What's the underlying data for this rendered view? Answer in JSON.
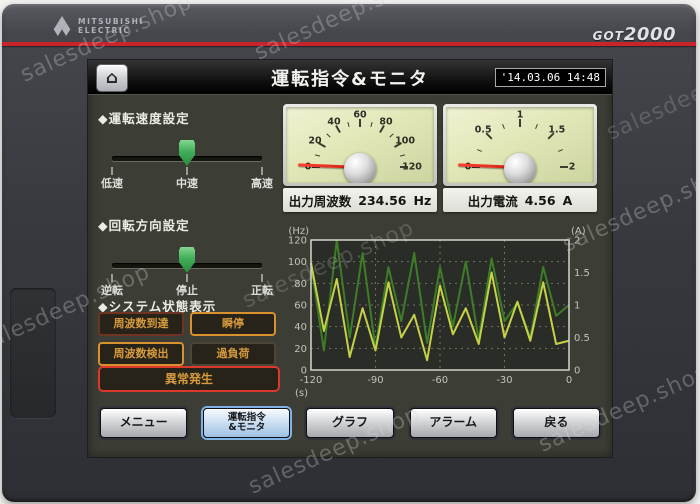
{
  "device": {
    "brand_line1": "MITSUBISHI",
    "brand_line2": "ELECTRIC",
    "model_prefix": "GOT",
    "model_number": "2000"
  },
  "watermark": "salesdeep.shop",
  "header": {
    "title": "運転指令&モニタ",
    "datetime": "'14.03.06 14:48",
    "home_icon": "⌂"
  },
  "speed_section": {
    "title": "◆運転速度設定",
    "labels": [
      "低速",
      "中速",
      "高速"
    ],
    "value_index": 1
  },
  "direction_section": {
    "title": "◆回転方向設定",
    "labels": [
      "逆転",
      "停止",
      "正転"
    ],
    "value_index": 1
  },
  "status_section": {
    "title": "◆システム状態表示",
    "items": [
      {
        "label": "周波数到達",
        "state": "dimred"
      },
      {
        "label": "瞬停",
        "state": "amber"
      },
      {
        "label": "周波数検出",
        "state": "amber"
      },
      {
        "label": "過負荷",
        "state": "dim"
      }
    ],
    "alarm": {
      "label": "異常発生",
      "state": "red"
    }
  },
  "gauges": [
    {
      "name": "output-frequency-gauge",
      "ticks": [
        0,
        20,
        40,
        60,
        80,
        100,
        120
      ],
      "minor_step": 10,
      "max": 120,
      "value": 0,
      "readout_label": "出力周波数",
      "readout_value": "234.56",
      "unit": "Hz"
    },
    {
      "name": "output-current-gauge",
      "ticks": [
        0,
        0.5,
        1,
        1.5,
        2
      ],
      "minor_step": 0.25,
      "max": 2,
      "value": 0,
      "readout_label": "出力電流",
      "readout_value": "4.56",
      "unit": "A"
    }
  ],
  "chart_data": {
    "type": "line",
    "x": [
      -120,
      -114,
      -108,
      -102,
      -96,
      -90,
      -84,
      -78,
      -72,
      -66,
      -60,
      -54,
      -48,
      -42,
      -36,
      -30,
      -24,
      -18,
      -12,
      -6,
      0
    ],
    "series": [
      {
        "name": "出力周波数",
        "axis": "left",
        "color": "#3e7d28",
        "values": [
          98,
          18,
          120,
          30,
          108,
          20,
          95,
          45,
          108,
          25,
          95,
          40,
          100,
          28,
          103,
          45,
          62,
          30,
          95,
          50,
          60
        ]
      },
      {
        "name": "出力電流",
        "axis": "right",
        "color": "#c6d147",
        "values": [
          1.65,
          0.6,
          1.4,
          0.2,
          0.95,
          0.3,
          1.35,
          0.5,
          0.85,
          0.15,
          1.3,
          0.55,
          0.95,
          0.4,
          1.5,
          0.5,
          1.05,
          0.45,
          1.35,
          0.4,
          0.45
        ]
      }
    ],
    "left_axis": {
      "label": "(Hz)",
      "ticks": [
        0,
        20,
        40,
        60,
        80,
        100,
        120
      ],
      "range": [
        0,
        120
      ]
    },
    "right_axis": {
      "label": "(A)",
      "ticks": [
        0,
        0.5,
        1,
        1.5,
        2
      ],
      "range": [
        0,
        2
      ]
    },
    "x_axis": {
      "label": "(s)",
      "ticks": [
        -120,
        -90,
        -60,
        -30,
        0
      ],
      "range": [
        -120,
        0
      ]
    },
    "grid": "dashed",
    "legend": "none"
  },
  "footer": {
    "buttons": [
      {
        "label": "メニュー",
        "selected": false
      },
      {
        "label": "運転指令&モニタ",
        "label_lines": [
          "運転指令",
          "&モニタ"
        ],
        "selected": true
      },
      {
        "label": "グラフ",
        "selected": false
      },
      {
        "label": "アラーム",
        "selected": false
      },
      {
        "label": "戻る",
        "selected": false
      }
    ]
  },
  "colors": {
    "accent_red": "#c8242b",
    "lamp_text": "#d69a3c",
    "alarm_border": "#dd382c",
    "active_lamp_border": "#d8912e",
    "slider_handle_green": "#3fae57",
    "screen_bg": "#3c3e35",
    "chart_plot_bg": "#2a2c27"
  }
}
